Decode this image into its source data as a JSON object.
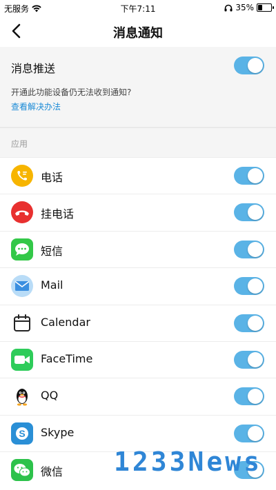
{
  "status_bar": {
    "carrier": "无服务",
    "time": "下午7:11",
    "battery": "35%",
    "battery_level": 0.35
  },
  "nav": {
    "title": "消息通知"
  },
  "push": {
    "label": "消息推送",
    "enabled": true,
    "hint": "开通此功能设备仍无法收到通知?",
    "link": "查看解决办法"
  },
  "section": {
    "header": "应用"
  },
  "apps": [
    {
      "name": "电话",
      "icon": "phone-icon",
      "enabled": true
    },
    {
      "name": "挂电话",
      "icon": "hang-up-icon",
      "enabled": true
    },
    {
      "name": "短信",
      "icon": "sms-icon",
      "enabled": true
    },
    {
      "name": "Mail",
      "icon": "mail-icon",
      "enabled": true
    },
    {
      "name": "Calendar",
      "icon": "calendar-icon",
      "enabled": true
    },
    {
      "name": "FaceTime",
      "icon": "facetime-icon",
      "enabled": true
    },
    {
      "name": "QQ",
      "icon": "qq-icon",
      "enabled": true
    },
    {
      "name": "Skype",
      "icon": "skype-icon",
      "enabled": true
    },
    {
      "name": "微信",
      "icon": "wechat-icon",
      "enabled": true
    }
  ],
  "watermark": "1233News",
  "colors": {
    "accent": "#5ab3e6",
    "link": "#1a8ad6"
  }
}
